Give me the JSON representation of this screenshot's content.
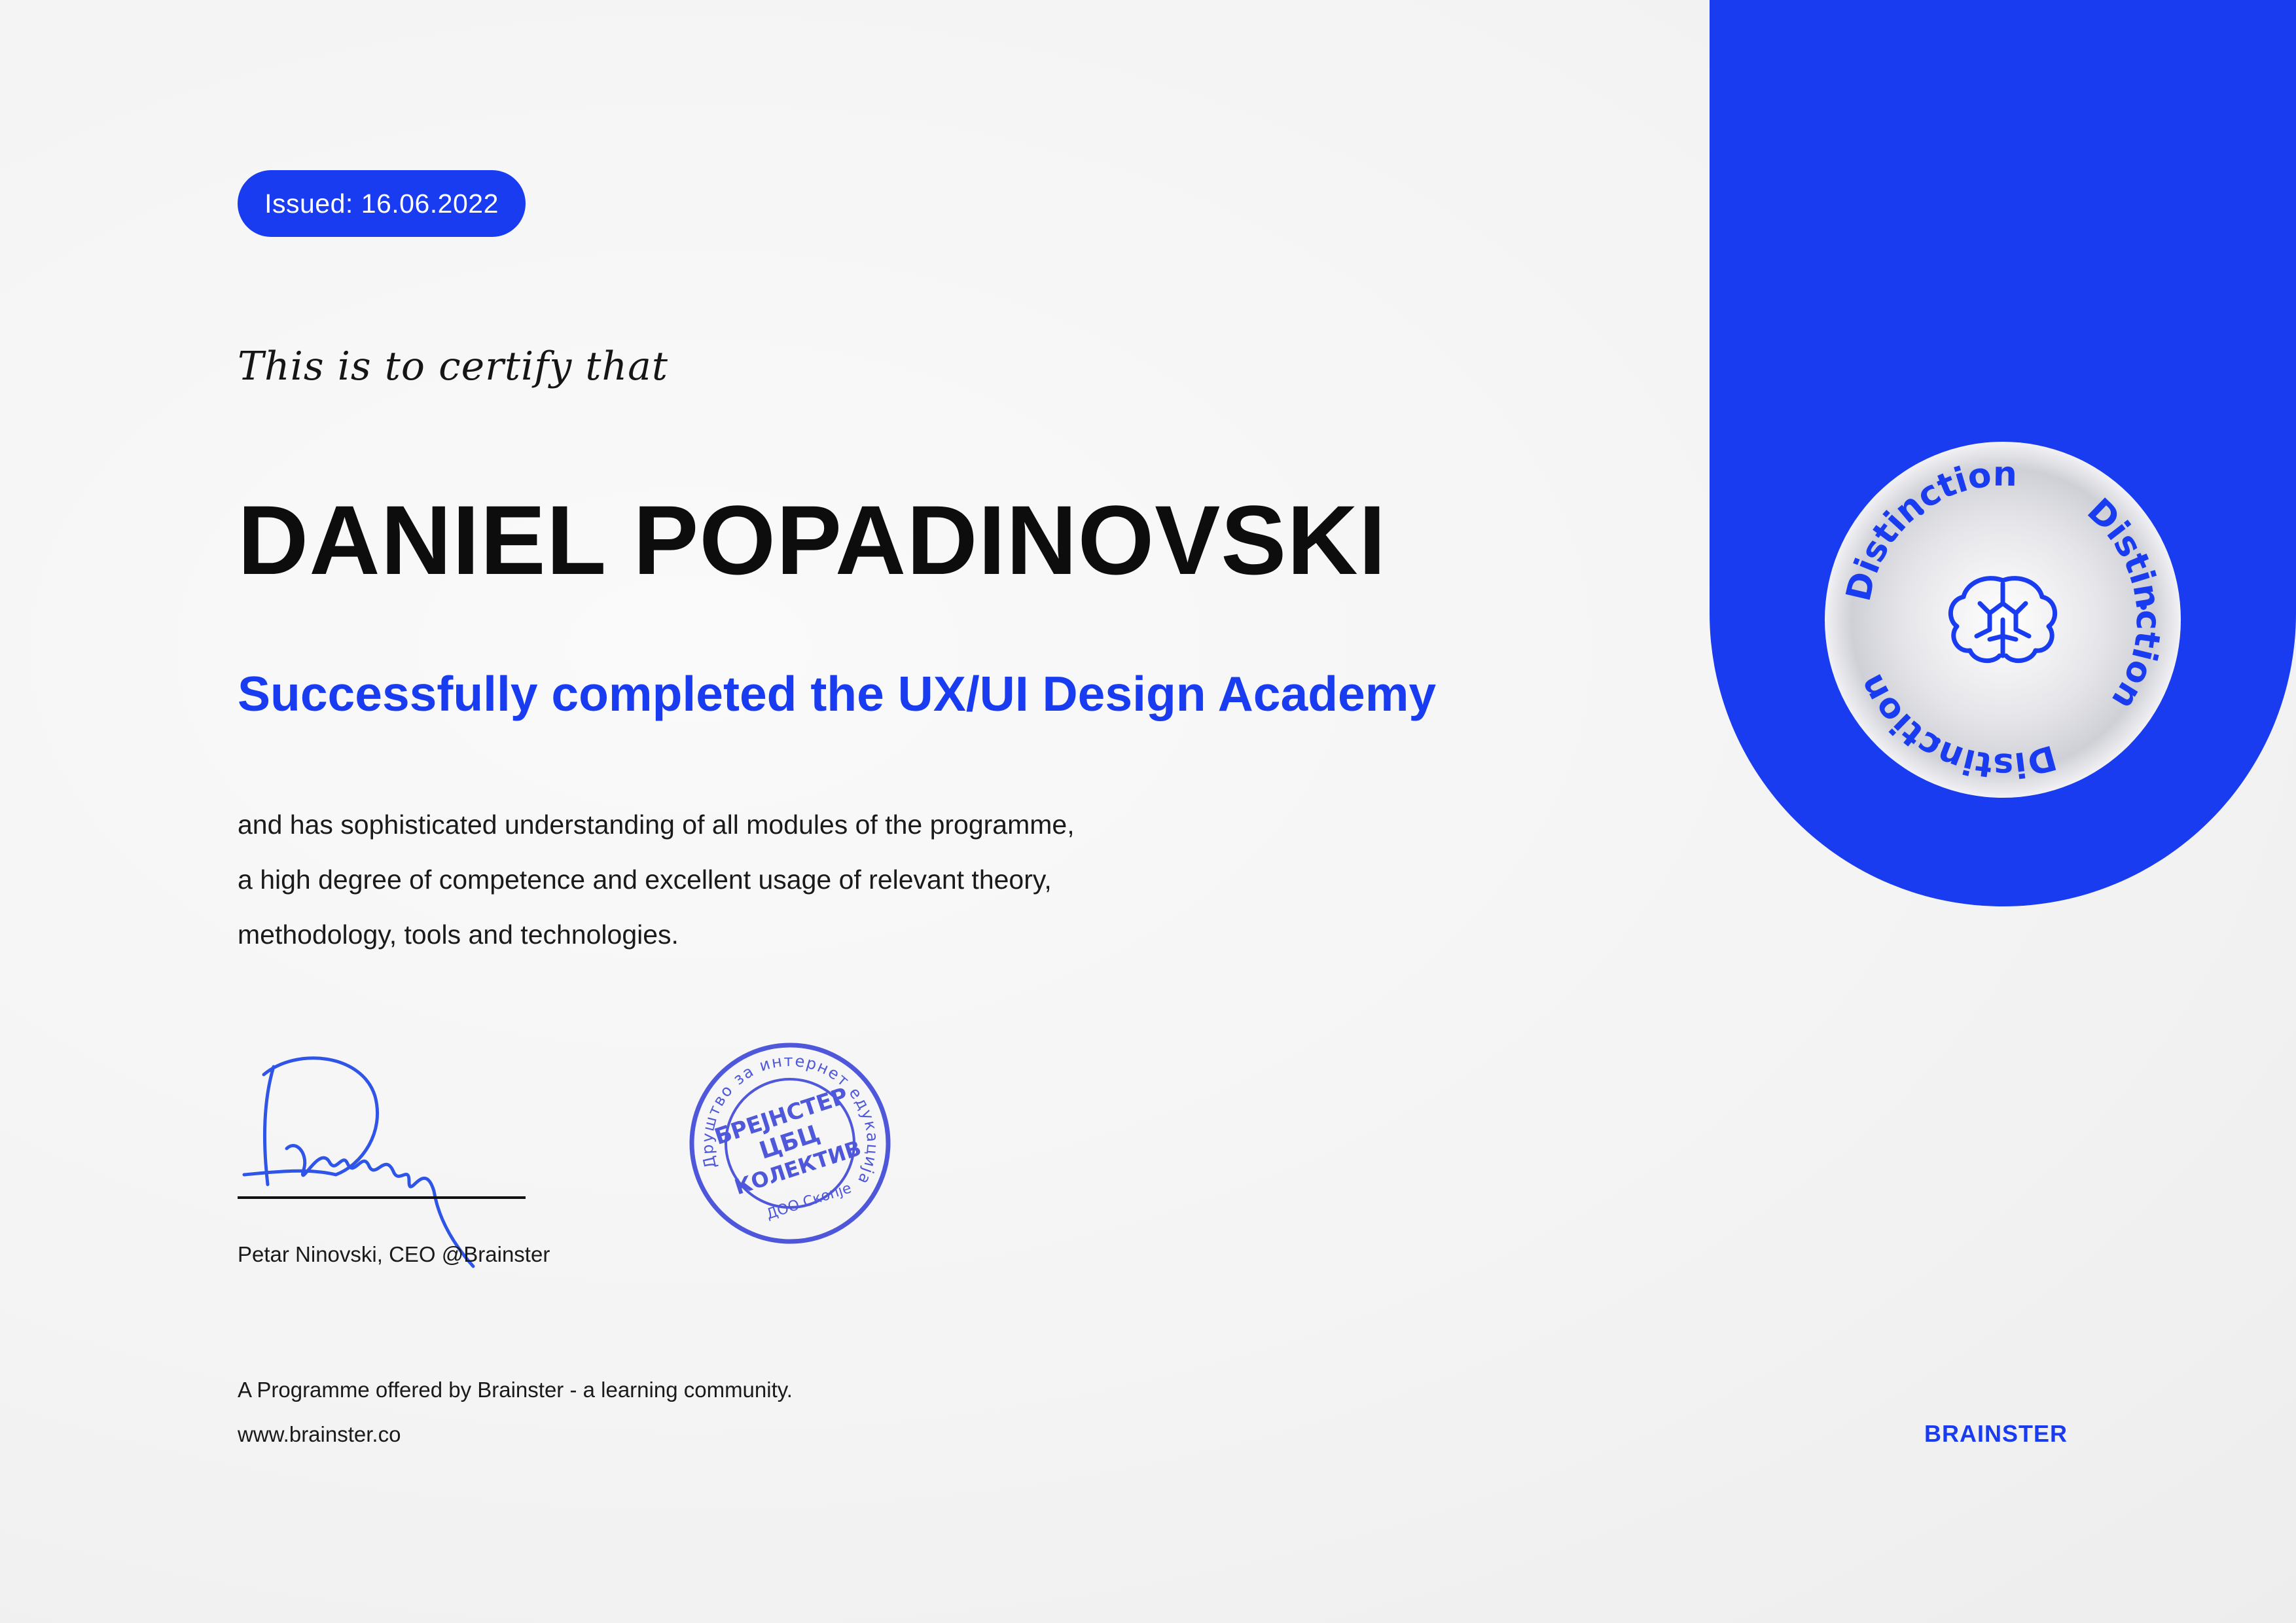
{
  "issued_badge": {
    "label": "Issued: 16.06.2022"
  },
  "certify_line": "This is to certify that",
  "recipient_name": "DANIEL POPADINOVSKI",
  "completion_line": "Successfully completed the UX/UI Design Academy",
  "description_lines": [
    "and has sophisticated understanding of all modules of the programme,",
    "a high degree of competence and excellent usage of relevant theory,",
    "methodology, tools and technologies."
  ],
  "signer_caption": "Petar Ninovski, CEO @Brainster",
  "stamp": {
    "outer_text": "Друштво за интернет едукација",
    "line1": "БРЕЈНСТЕР",
    "line2": "ЦБЦ",
    "line3": "КОЛЕКТИВ",
    "bottom_text": "ДОО Скопје"
  },
  "seal": {
    "ring_text": "Distinction",
    "icon": "brain-icon"
  },
  "footer": {
    "programme_line": "A Programme offered by Brainster - a learning community.",
    "website": "www.brainster.co"
  },
  "brand_wordmark": "BRAINSTER",
  "colors": {
    "brand_blue": "#1a3cf0",
    "text_dark": "#111111",
    "background": "#f4f4f4"
  }
}
